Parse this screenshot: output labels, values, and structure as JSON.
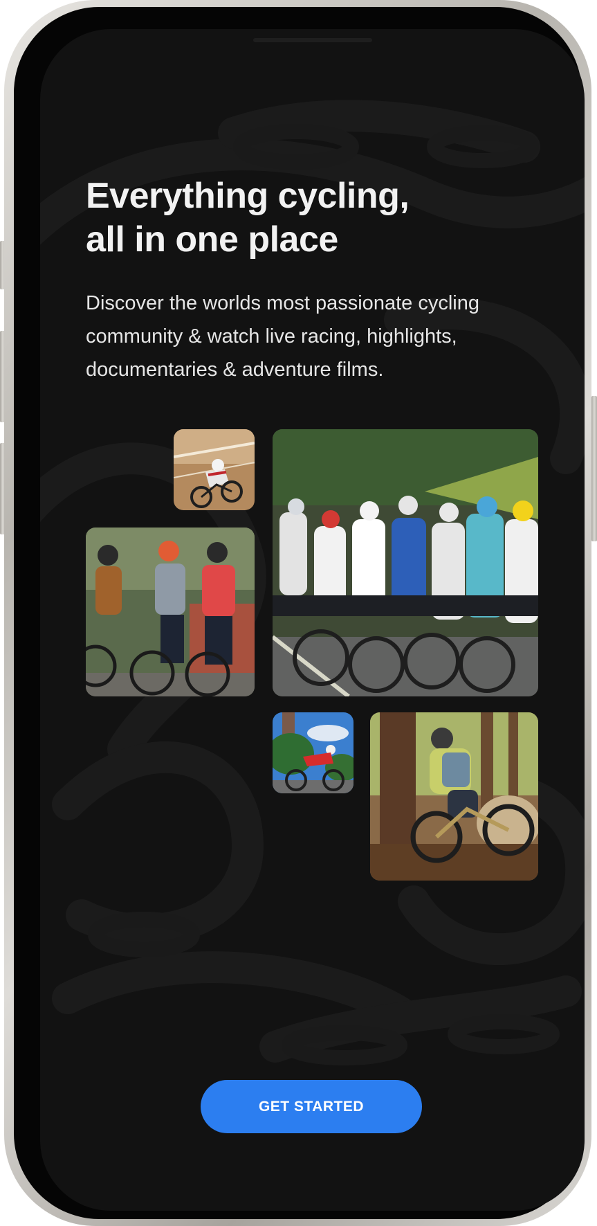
{
  "onboarding": {
    "headline_line1": "Everything cycling,",
    "headline_line2": "all in one place",
    "subtitle": "Discover the worlds most passionate cycling community & watch live racing, highlights, documentaries & adventure films.",
    "cta_label": "GET STARTED"
  },
  "photos": [
    {
      "subject": "track cyclist on velodrome"
    },
    {
      "subject": "three riders chatting on road bikes"
    },
    {
      "subject": "pro peloton road race"
    },
    {
      "subject": "road cyclist under blue sky"
    },
    {
      "subject": "mountain biker in forest"
    }
  ],
  "colors": {
    "background": "#121212",
    "accent": "#2c7ef0",
    "text": "#f2f2f2"
  }
}
